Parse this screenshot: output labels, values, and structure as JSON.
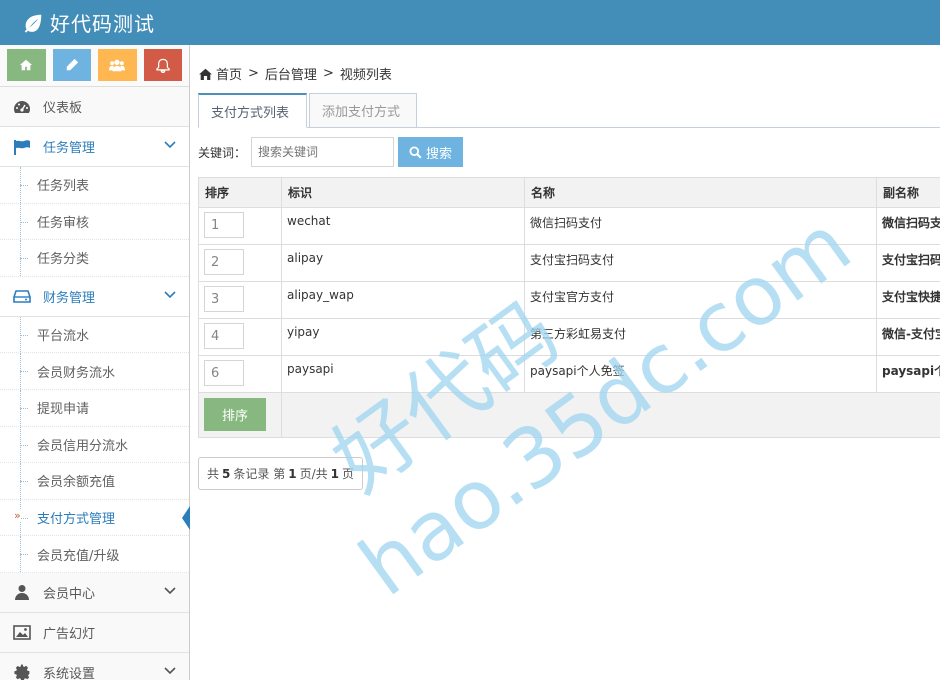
{
  "app": {
    "title": "好代码测试"
  },
  "shortcuts": [
    {
      "icon": "home-icon",
      "color": "#87b87f"
    },
    {
      "icon": "pencil-icon",
      "color": "#6fb3e0"
    },
    {
      "icon": "users-icon",
      "color": "#ffb752"
    },
    {
      "icon": "bell-icon",
      "color": "#d15b47"
    }
  ],
  "sidebar": {
    "dashboard": "仪表板",
    "tasks": {
      "label": "任务管理",
      "items": [
        "任务列表",
        "任务审核",
        "任务分类"
      ]
    },
    "finance": {
      "label": "财务管理",
      "items": [
        "平台流水",
        "会员财务流水",
        "提现申请",
        "会员信用分流水",
        "会员余额充值",
        "支付方式管理",
        "会员充值/升级"
      ],
      "active_marker": "»"
    },
    "members": "会员中心",
    "ads": "广告幻灯",
    "settings": "系统设置"
  },
  "breadcrumb": {
    "home": "首页",
    "sep": ">",
    "admin": "后台管理",
    "current": "视频列表"
  },
  "tabs": [
    "支付方式列表",
    "添加支付方式"
  ],
  "search": {
    "label": "关键词：",
    "placeholder": "搜索关键词",
    "button": "搜索"
  },
  "table": {
    "headers": [
      "排序",
      "标识",
      "名称",
      "副名称"
    ],
    "rows": [
      {
        "order": "1",
        "id": "wechat",
        "name": "微信扫码支付",
        "sub": "微信扫码支付"
      },
      {
        "order": "2",
        "id": "alipay",
        "name": "支付宝扫码支付",
        "sub": "支付宝扫码支付"
      },
      {
        "order": "3",
        "id": "alipay_wap",
        "name": "支付宝官方支付",
        "sub": "支付宝快捷支付"
      },
      {
        "order": "4",
        "id": "yipay",
        "name": "第三方彩虹易支付",
        "sub": "微信-支付宝"
      },
      {
        "order": "6",
        "id": "paysapi",
        "name": "paysapi个人免签",
        "sub": "paysapi个人免签"
      }
    ],
    "sort_button": "排序"
  },
  "pager": {
    "prefix": "共",
    "total": "5",
    "mid": "条记录 第",
    "page": "1",
    "sep": "页/共",
    "pages": "1",
    "suffix": "页"
  },
  "watermark": {
    "line1": "好代码",
    "line2": "hao.35dc.com"
  },
  "colors": {
    "header": "#438eb9",
    "accent": "#2b7dbc",
    "search_btn": "#6fb3e0",
    "sort_btn": "#87b87f"
  }
}
